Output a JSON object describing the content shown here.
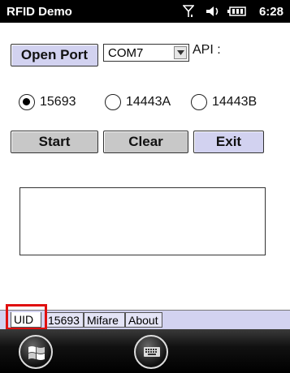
{
  "status_bar": {
    "title": "RFID Demo",
    "time": "6:28",
    "icons": [
      "signal-icon",
      "volume-icon",
      "battery-icon"
    ]
  },
  "toolbar": {
    "open_port_label": "Open Port",
    "port_select_value": "COM7",
    "api_label": "API :"
  },
  "protocols": {
    "options": [
      {
        "label": "15693",
        "selected": true
      },
      {
        "label": "14443A",
        "selected": false
      },
      {
        "label": "14443B",
        "selected": false
      }
    ]
  },
  "actions": {
    "start_label": "Start",
    "clear_label": "Clear",
    "exit_label": "Exit"
  },
  "output": {
    "text": ""
  },
  "tabs": [
    {
      "label": "UID",
      "active": true
    },
    {
      "label": "15693",
      "active": false
    },
    {
      "label": "Mifare",
      "active": false
    },
    {
      "label": "About",
      "active": false
    }
  ],
  "taskbar": {
    "icons": [
      "windows-start-icon",
      "keyboard-icon"
    ]
  },
  "colors": {
    "button_fill": "#d2d2f0",
    "button_gray": "#c8c8c8",
    "highlight": "#e01010"
  }
}
